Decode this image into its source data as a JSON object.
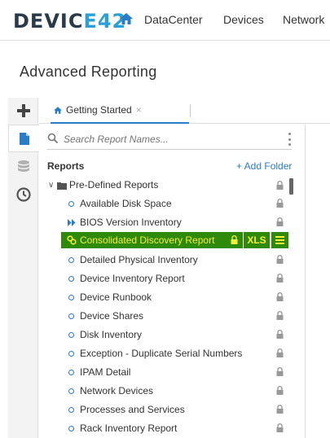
{
  "header": {
    "logo_main": "DEVIC",
    "logo_accent": "E42",
    "nav": [
      "DataCenter",
      "Devices",
      "Network"
    ]
  },
  "page_title": "Advanced Reporting",
  "tab": {
    "label": "Getting Started",
    "close": "×"
  },
  "search": {
    "placeholder": "Search Report Names..."
  },
  "reports": {
    "heading": "Reports",
    "add_folder": "+ Add Folder",
    "folder": "Pre-Defined Reports",
    "items": [
      {
        "label": "Available Disk Space",
        "icon": "circle"
      },
      {
        "label": "BIOS Version Inventory",
        "icon": "double-chevron"
      },
      {
        "label": "Consolidated Discovery Report",
        "icon": "chain",
        "selected": true
      },
      {
        "label": "Detailed Physical Inventory",
        "icon": "circle"
      },
      {
        "label": "Device Inventory Report",
        "icon": "circle"
      },
      {
        "label": "Device Runbook",
        "icon": "circle"
      },
      {
        "label": "Device Shares",
        "icon": "circle"
      },
      {
        "label": "Disk Inventory",
        "icon": "circle"
      },
      {
        "label": "Exception - Duplicate Serial Numbers",
        "icon": "circle"
      },
      {
        "label": "IPAM Detail",
        "icon": "circle"
      },
      {
        "label": "Network Devices",
        "icon": "circle"
      },
      {
        "label": "Processes and Services",
        "icon": "circle"
      },
      {
        "label": "Rack Inventory Report",
        "icon": "circle"
      }
    ],
    "selected_actions": {
      "xls": "XLS"
    }
  },
  "colors": {
    "accent": "#2a7cc7",
    "selected_bg": "#2e8b0a",
    "selected_text": "#f2ee3a"
  }
}
